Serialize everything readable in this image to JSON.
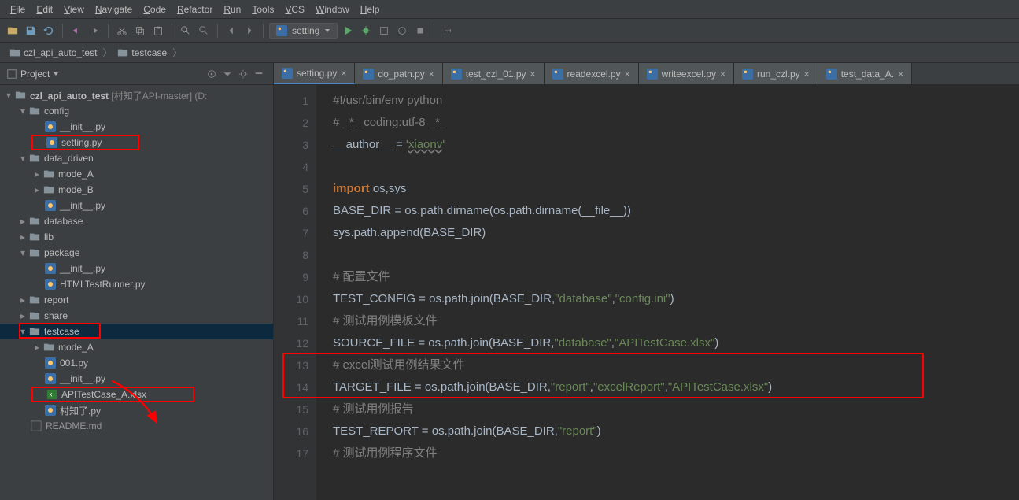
{
  "menu": [
    "File",
    "Edit",
    "View",
    "Navigate",
    "Code",
    "Refactor",
    "Run",
    "Tools",
    "VCS",
    "Window",
    "Help"
  ],
  "runConfig": "setting",
  "breadcrumb": {
    "root": "czl_api_auto_test",
    "item": "testcase"
  },
  "projectTool": {
    "title": "Project"
  },
  "tree": {
    "root": {
      "name": "czl_api_auto_test",
      "suffix": " [村知了API-master] (D:"
    },
    "config": "config",
    "config_init": "__init__.py",
    "config_setting": "setting.py",
    "data_driven": "data_driven",
    "mode_a": "mode_A",
    "mode_b": "mode_B",
    "dd_init": "__init__.py",
    "database": "database",
    "lib": "lib",
    "package": "package",
    "pkg_init": "__init__.py",
    "pkg_runner": "HTMLTestRunner.py",
    "report": "report",
    "share": "share",
    "testcase": "testcase",
    "tc_mode_a": "mode_A",
    "tc_001": "001.py",
    "tc_init": "__init__.py",
    "tc_xlsx": "APITestCase_A.xlsx",
    "tc_cun": "村知了.py",
    "readme": "README.md"
  },
  "tabs": [
    {
      "label": "setting.py",
      "active": true
    },
    {
      "label": "do_path.py"
    },
    {
      "label": "test_czl_01.py"
    },
    {
      "label": "readexcel.py"
    },
    {
      "label": "writeexcel.py"
    },
    {
      "label": "run_czl.py"
    },
    {
      "label": "test_data_A."
    }
  ],
  "code": {
    "l1": "#!/usr/bin/env python",
    "l2": "# _*_ coding:utf-8 _*_",
    "l3a": "__author__ = ",
    "l3b": "'",
    "l3c": "xiaonv",
    "l3d": "'",
    "l5a": "import",
    "l5b": " os,sys",
    "l6": "BASE_DIR = os.path.dirname(os.path.dirname(__file__))",
    "l7": "sys.path.append(BASE_DIR)",
    "l9": "# 配置文件",
    "l10a": "TEST_CONFIG = ",
    "l10b": "os.path.join(BASE_DIR,",
    "l10c": "\"database\"",
    "l10d": ",",
    "l10e": "\"config.ini\"",
    "l10f": ")",
    "l11": "# 测试用例模板文件",
    "l12a": "SOURCE_FILE = os.path.join(BASE_DIR,",
    "l12b": "\"database\"",
    "l12c": ",",
    "l12d": "\"APITestCase.xlsx\"",
    "l12e": ")",
    "l13": "# excel测试用例结果文件",
    "l14a": "TARGET_FILE = os.path.join(BASE_DIR,",
    "l14b": "\"report\"",
    "l14c": ",",
    "l14d": "\"excelReport\"",
    "l14e": ",",
    "l14f": "\"APITestCase.xlsx\"",
    "l14g": ")",
    "l15": "# 测试用例报告",
    "l16a": "TEST_REPORT = os.path.join(BASE_DIR,",
    "l16b": "\"report\"",
    "l16c": ")",
    "l17": "# 测试用例程序文件"
  }
}
